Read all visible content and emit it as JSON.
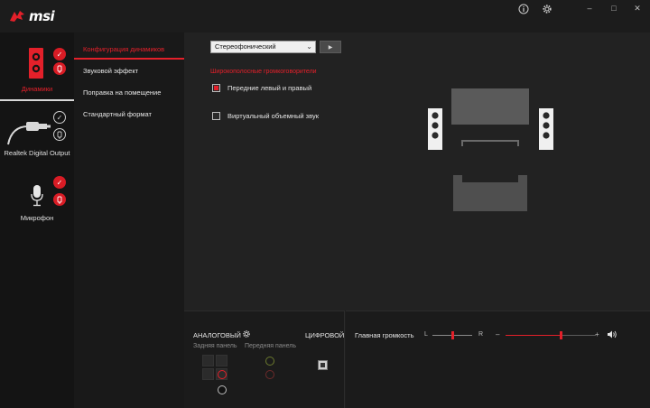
{
  "app": {
    "brand": "msi",
    "info_icon": "info-icon",
    "settings_icon": "gear-icon",
    "minimize": "–",
    "maximize": "□",
    "close": "✕"
  },
  "devices": [
    {
      "label": "Динамики",
      "icon": "speaker-icon",
      "active": true
    },
    {
      "label": "Realtek Digital Output",
      "icon": "optical-cable-icon",
      "active": false
    },
    {
      "label": "Микрофон",
      "icon": "microphone-icon",
      "active": false
    }
  ],
  "menu": {
    "items": [
      {
        "label": "Конфигурация динамиков",
        "active": true
      },
      {
        "label": "Звуковой эффект",
        "active": false
      },
      {
        "label": "Поправка на помещение",
        "active": false
      },
      {
        "label": "Стандартный формат",
        "active": false
      }
    ]
  },
  "main": {
    "config_select": "Стереофонический",
    "section_title": "Широкополосные громкоговорители",
    "checkboxes": [
      {
        "label": "Передние левый и правый",
        "checked": true
      },
      {
        "label": "Виртуальный объемный звук",
        "checked": false
      }
    ]
  },
  "bottom": {
    "analog_label": "АНАЛОГОВЫЙ",
    "digital_label": "ЦИФРОВОЙ",
    "rear_panel": "Задняя панель",
    "front_panel": "Передняя панель",
    "volume_label": "Главная громкость",
    "balance_left": "L",
    "balance_right": "R",
    "minus": "–",
    "plus": "+",
    "balance_position": 0.5,
    "volume_level": 0.61
  },
  "colors": {
    "accent": "#e3202a",
    "background": "#1e1e1e"
  }
}
